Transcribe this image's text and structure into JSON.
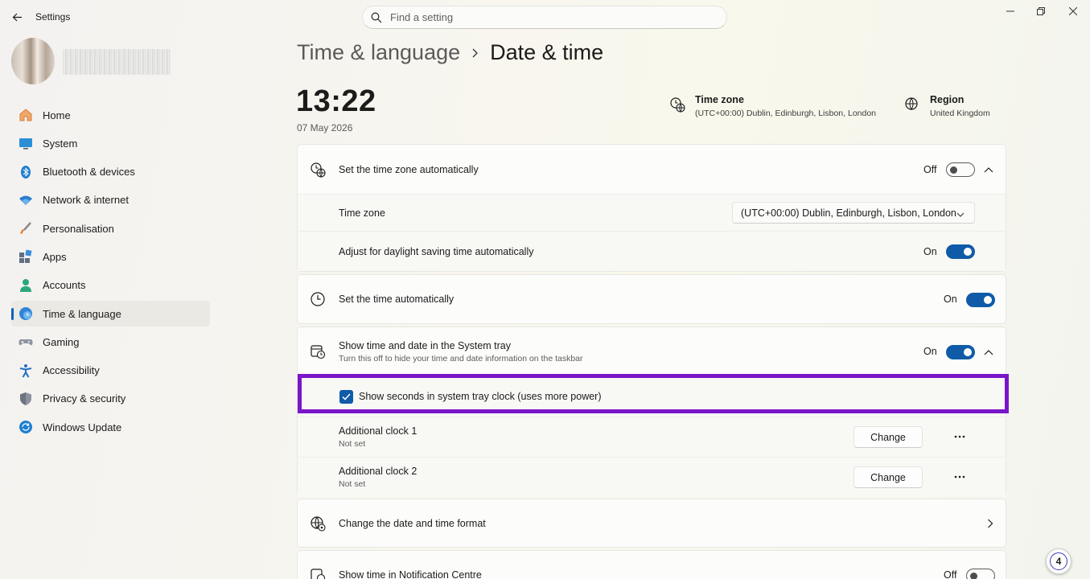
{
  "window": {
    "title": "Settings",
    "search_placeholder": "Find a setting"
  },
  "sidebar": {
    "items": [
      {
        "label": "Home",
        "icon": "home-icon"
      },
      {
        "label": "System",
        "icon": "system-icon"
      },
      {
        "label": "Bluetooth & devices",
        "icon": "bluetooth-icon"
      },
      {
        "label": "Network & internet",
        "icon": "wifi-icon"
      },
      {
        "label": "Personalisation",
        "icon": "brush-icon"
      },
      {
        "label": "Apps",
        "icon": "apps-icon"
      },
      {
        "label": "Accounts",
        "icon": "accounts-icon"
      },
      {
        "label": "Time & language",
        "icon": "time-language-icon",
        "active": true
      },
      {
        "label": "Gaming",
        "icon": "gamepad-icon"
      },
      {
        "label": "Accessibility",
        "icon": "accessibility-icon"
      },
      {
        "label": "Privacy & security",
        "icon": "shield-icon"
      },
      {
        "label": "Windows Update",
        "icon": "update-icon"
      }
    ]
  },
  "breadcrumb": {
    "parent": "Time & language",
    "current": "Date & time"
  },
  "clock": {
    "time": "13:22",
    "date": "07 May 2026"
  },
  "summary": {
    "timezone_title": "Time zone",
    "timezone_value": "(UTC+00:00) Dublin, Edinburgh, Lisbon, London",
    "region_title": "Region",
    "region_value": "United Kingdom"
  },
  "settings": {
    "auto_timezone": {
      "label": "Set the time zone automatically",
      "state": "Off"
    },
    "timezone": {
      "label": "Time zone",
      "value": "(UTC+00:00) Dublin, Edinburgh, Lisbon, London"
    },
    "daylight": {
      "label": "Adjust for daylight saving time automatically",
      "state": "On"
    },
    "auto_time": {
      "label": "Set the time automatically",
      "state": "On"
    },
    "tray": {
      "label": "Show time and date in the System tray",
      "sub": "Turn this off to hide your time and date information on the taskbar",
      "state": "On"
    },
    "seconds": {
      "label": "Show seconds in system tray clock (uses more power)",
      "checked": true
    },
    "clock1": {
      "label": "Additional clock 1",
      "sub": "Not set",
      "button": "Change"
    },
    "clock2": {
      "label": "Additional clock 2",
      "sub": "Not set",
      "button": "Change"
    },
    "format": {
      "label": "Change the date and time format"
    },
    "notification": {
      "label": "Show time in Notification Centre",
      "state": "Off"
    }
  },
  "colors": {
    "accent": "#0f5ba8",
    "highlight": "#7a16c9"
  },
  "badge": {
    "number": "4"
  }
}
